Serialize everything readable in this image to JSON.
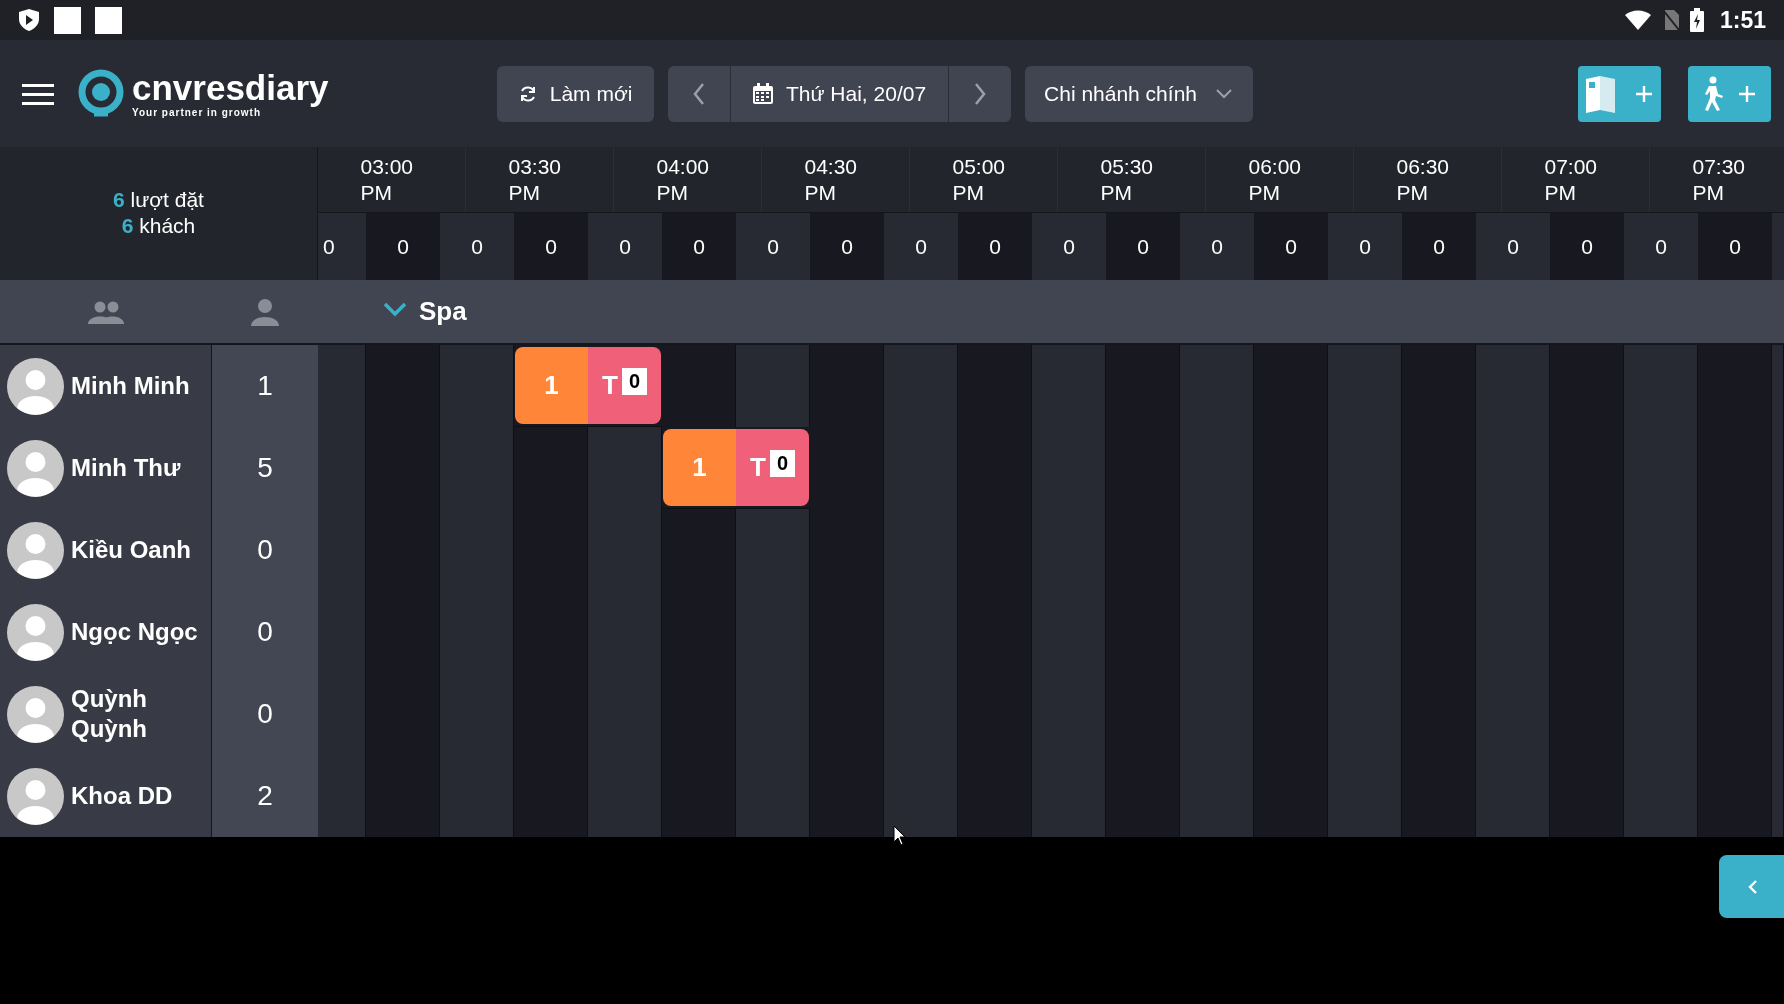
{
  "status_bar": {
    "time": "1:51"
  },
  "toolbar": {
    "logo": {
      "name": "cnvresdiary",
      "tagline": "Your partner in growth"
    },
    "refresh_button": "Làm mới",
    "date": "Thứ Hai, 20/07",
    "branch": "Chi nhánh chính"
  },
  "summary": [
    {
      "count": "6",
      "label": "lượt đặt"
    },
    {
      "count": "6",
      "label": "khách"
    }
  ],
  "time_slots": [
    "03:00 PM",
    "03:30 PM",
    "04:00 PM",
    "04:30 PM",
    "05:00 PM",
    "05:30 PM",
    "06:00 PM",
    "06:30 PM",
    "07:00 PM",
    "07:30 PM"
  ],
  "slot_counts": [
    "0",
    "0",
    "0",
    "0",
    "0",
    "0",
    "0",
    "0",
    "0",
    "0",
    "0",
    "0",
    "0",
    "0",
    "0",
    "0",
    "0",
    "0",
    "0",
    "0"
  ],
  "group": {
    "name": "Spa",
    "expanded": true
  },
  "staff": [
    {
      "name": "Minh Minh",
      "count": "1",
      "slots": [
        {
          "kind": "empty"
        },
        {
          "kind": "empty"
        },
        {
          "kind": "empty"
        },
        {
          "kind": "booking",
          "guests": "1",
          "tag": "T",
          "badge": "0"
        },
        {
          "kind": "empty"
        },
        {
          "kind": "empty"
        },
        {
          "kind": "empty"
        },
        {
          "kind": "empty"
        },
        {
          "kind": "empty"
        },
        {
          "kind": "empty"
        },
        {
          "kind": "empty"
        },
        {
          "kind": "empty"
        },
        {
          "kind": "empty"
        },
        {
          "kind": "empty"
        },
        {
          "kind": "empty"
        },
        {
          "kind": "empty"
        },
        {
          "kind": "empty"
        },
        {
          "kind": "empty"
        },
        {
          "kind": "empty"
        },
        {
          "kind": "empty"
        }
      ]
    },
    {
      "name": "Minh Thư",
      "count": "5",
      "slots": [
        {
          "kind": "empty"
        },
        {
          "kind": "empty"
        },
        {
          "kind": "empty"
        },
        {
          "kind": "empty"
        },
        {
          "kind": "empty"
        },
        {
          "kind": "booking",
          "guests": "1",
          "tag": "T",
          "badge": "0"
        },
        {
          "kind": "empty"
        },
        {
          "kind": "empty"
        },
        {
          "kind": "empty"
        },
        {
          "kind": "empty"
        },
        {
          "kind": "empty"
        },
        {
          "kind": "empty"
        },
        {
          "kind": "empty"
        },
        {
          "kind": "empty"
        },
        {
          "kind": "empty"
        },
        {
          "kind": "empty"
        },
        {
          "kind": "empty"
        },
        {
          "kind": "empty"
        },
        {
          "kind": "empty"
        },
        {
          "kind": "empty"
        }
      ]
    },
    {
      "name": "Kiều Oanh",
      "count": "0",
      "slots": [
        {
          "kind": "empty"
        },
        {
          "kind": "empty"
        },
        {
          "kind": "empty"
        },
        {
          "kind": "empty"
        },
        {
          "kind": "empty"
        },
        {
          "kind": "empty"
        },
        {
          "kind": "empty"
        },
        {
          "kind": "empty"
        },
        {
          "kind": "empty"
        },
        {
          "kind": "empty"
        },
        {
          "kind": "empty"
        },
        {
          "kind": "empty"
        },
        {
          "kind": "empty"
        },
        {
          "kind": "empty"
        },
        {
          "kind": "empty"
        },
        {
          "kind": "empty"
        },
        {
          "kind": "empty"
        },
        {
          "kind": "empty"
        },
        {
          "kind": "empty"
        },
        {
          "kind": "empty"
        },
        {
          "kind": "empty"
        }
      ]
    },
    {
      "name": "Ngọc Ngọc",
      "count": "0",
      "slots": [
        {
          "kind": "empty"
        },
        {
          "kind": "empty"
        },
        {
          "kind": "empty"
        },
        {
          "kind": "empty"
        },
        {
          "kind": "empty"
        },
        {
          "kind": "empty"
        },
        {
          "kind": "empty"
        },
        {
          "kind": "empty"
        },
        {
          "kind": "empty"
        },
        {
          "kind": "empty"
        },
        {
          "kind": "empty"
        },
        {
          "kind": "empty"
        },
        {
          "kind": "empty"
        },
        {
          "kind": "empty"
        },
        {
          "kind": "empty"
        },
        {
          "kind": "empty"
        },
        {
          "kind": "empty"
        },
        {
          "kind": "empty"
        },
        {
          "kind": "empty"
        },
        {
          "kind": "empty"
        },
        {
          "kind": "empty"
        }
      ]
    },
    {
      "name": "Quỳnh Quỳnh",
      "count": "0",
      "slots": [
        {
          "kind": "empty"
        },
        {
          "kind": "empty"
        },
        {
          "kind": "empty"
        },
        {
          "kind": "empty"
        },
        {
          "kind": "empty"
        },
        {
          "kind": "empty"
        },
        {
          "kind": "empty"
        },
        {
          "kind": "empty"
        },
        {
          "kind": "empty"
        },
        {
          "kind": "empty"
        },
        {
          "kind": "empty"
        },
        {
          "kind": "empty"
        },
        {
          "kind": "empty"
        },
        {
          "kind": "empty"
        },
        {
          "kind": "empty"
        },
        {
          "kind": "empty"
        },
        {
          "kind": "empty"
        },
        {
          "kind": "empty"
        },
        {
          "kind": "empty"
        },
        {
          "kind": "empty"
        },
        {
          "kind": "empty"
        }
      ]
    },
    {
      "name": "Khoa DD",
      "count": "2",
      "slots": [
        {
          "kind": "empty"
        },
        {
          "kind": "empty"
        },
        {
          "kind": "empty"
        },
        {
          "kind": "empty"
        },
        {
          "kind": "empty"
        },
        {
          "kind": "empty"
        },
        {
          "kind": "empty"
        },
        {
          "kind": "empty"
        },
        {
          "kind": "empty"
        },
        {
          "kind": "empty"
        },
        {
          "kind": "empty"
        },
        {
          "kind": "empty"
        },
        {
          "kind": "empty"
        },
        {
          "kind": "empty"
        },
        {
          "kind": "empty"
        },
        {
          "kind": "empty"
        },
        {
          "kind": "empty"
        },
        {
          "kind": "empty"
        },
        {
          "kind": "empty"
        },
        {
          "kind": "empty"
        },
        {
          "kind": "empty"
        }
      ]
    }
  ]
}
